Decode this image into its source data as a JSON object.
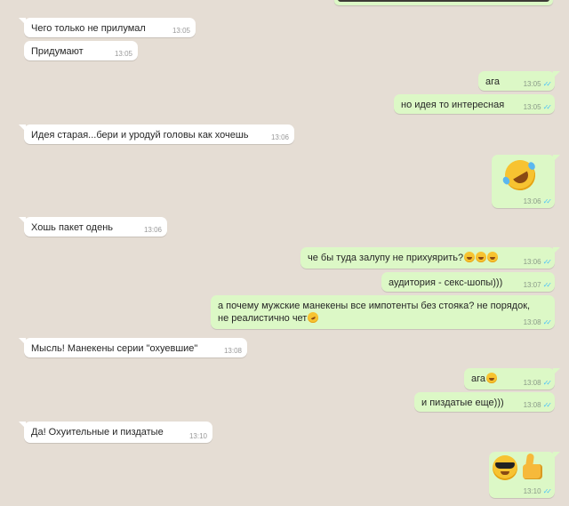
{
  "messages": [
    {
      "id": 1,
      "dir": "in",
      "text": "Чего только не прилумал",
      "time": "13:05"
    },
    {
      "id": 2,
      "dir": "in",
      "text": "Придумают",
      "time": "13:05"
    },
    {
      "id": 3,
      "dir": "out",
      "text": "ага",
      "time": "13:05"
    },
    {
      "id": 4,
      "dir": "out",
      "text": "но идея то интересная",
      "time": "13:05"
    },
    {
      "id": 5,
      "dir": "in",
      "text": "Идея старая...бери и уродуй головы как хочешь",
      "time": "13:06"
    },
    {
      "id": 6,
      "dir": "out",
      "text": "",
      "emoji": "rolling-on-floor-laughing",
      "time": "13:06"
    },
    {
      "id": 7,
      "dir": "in",
      "text": "Хошь пакет одень",
      "time": "13:06"
    },
    {
      "id": 8,
      "dir": "out",
      "text": "че бы туда залупу не прихуярить?",
      "emoji": "grinning-squinting x3",
      "time": "13:06"
    },
    {
      "id": 9,
      "dir": "out",
      "text": "аудитория - секс-шопы)))",
      "time": "13:07"
    },
    {
      "id": 10,
      "dir": "out",
      "text": "а почему мужские манекены все импотенты без стояка? не порядок, не реалистично чет",
      "emoji": "rolling-on-floor-laughing",
      "time": "13:08"
    },
    {
      "id": 11,
      "dir": "in",
      "text": "Мысль! Манекены серии \"охуевшие\"",
      "time": "13:08"
    },
    {
      "id": 12,
      "dir": "out",
      "text": "ага",
      "emoji": "grinning-squinting",
      "time": "13:08"
    },
    {
      "id": 13,
      "dir": "out",
      "text": "и пиздатые еще)))",
      "time": "13:08"
    },
    {
      "id": 14,
      "dir": "in",
      "text": "Да! Охуительные и пиздатые",
      "time": "13:10"
    },
    {
      "id": 15,
      "dir": "out",
      "text": "",
      "emoji": "sunglasses-face thumbs-up",
      "time": "13:10"
    }
  ],
  "top_time": "13:05",
  "colors": {
    "incoming": "#ffffff",
    "outgoing": "#dcf8c6",
    "background": "#e5ddd4",
    "read_ticks": "#4fc3f7"
  }
}
